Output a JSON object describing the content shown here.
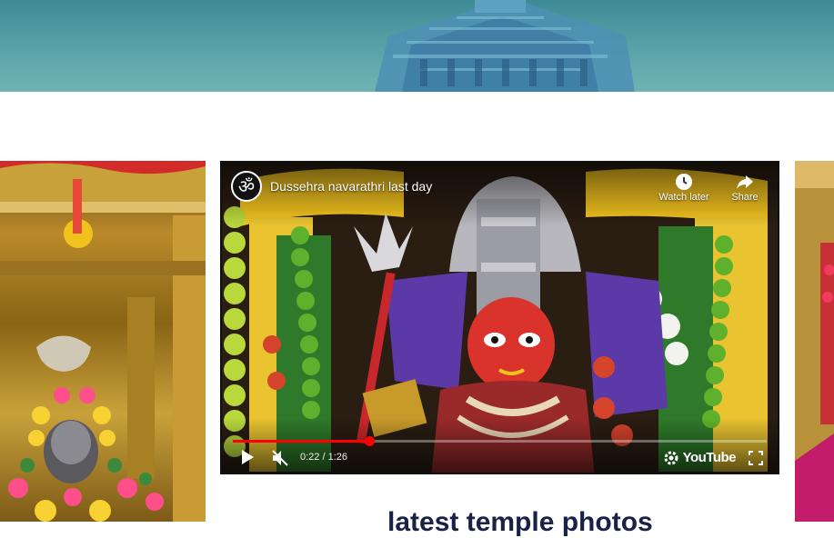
{
  "header": {
    "banner_image": "temple-gopuram-banner",
    "banner_color": "#5ba3a8"
  },
  "gallery": {
    "left_photo": "shiva-lingam-shrine-photo",
    "right_photo": "decorated-shrine-photo"
  },
  "video": {
    "title": "Dussehra navarathri last day",
    "channel_icon": "om-icon",
    "watch_later_label": "Watch later",
    "share_label": "Share",
    "current_time": "0:22",
    "duration": "1:26",
    "time_display": "0:22 / 1:26",
    "progress_fraction": 0.256,
    "platform_label": "YouTube",
    "accent_color": "#ff0000"
  },
  "section": {
    "heading": "latest temple photos"
  }
}
